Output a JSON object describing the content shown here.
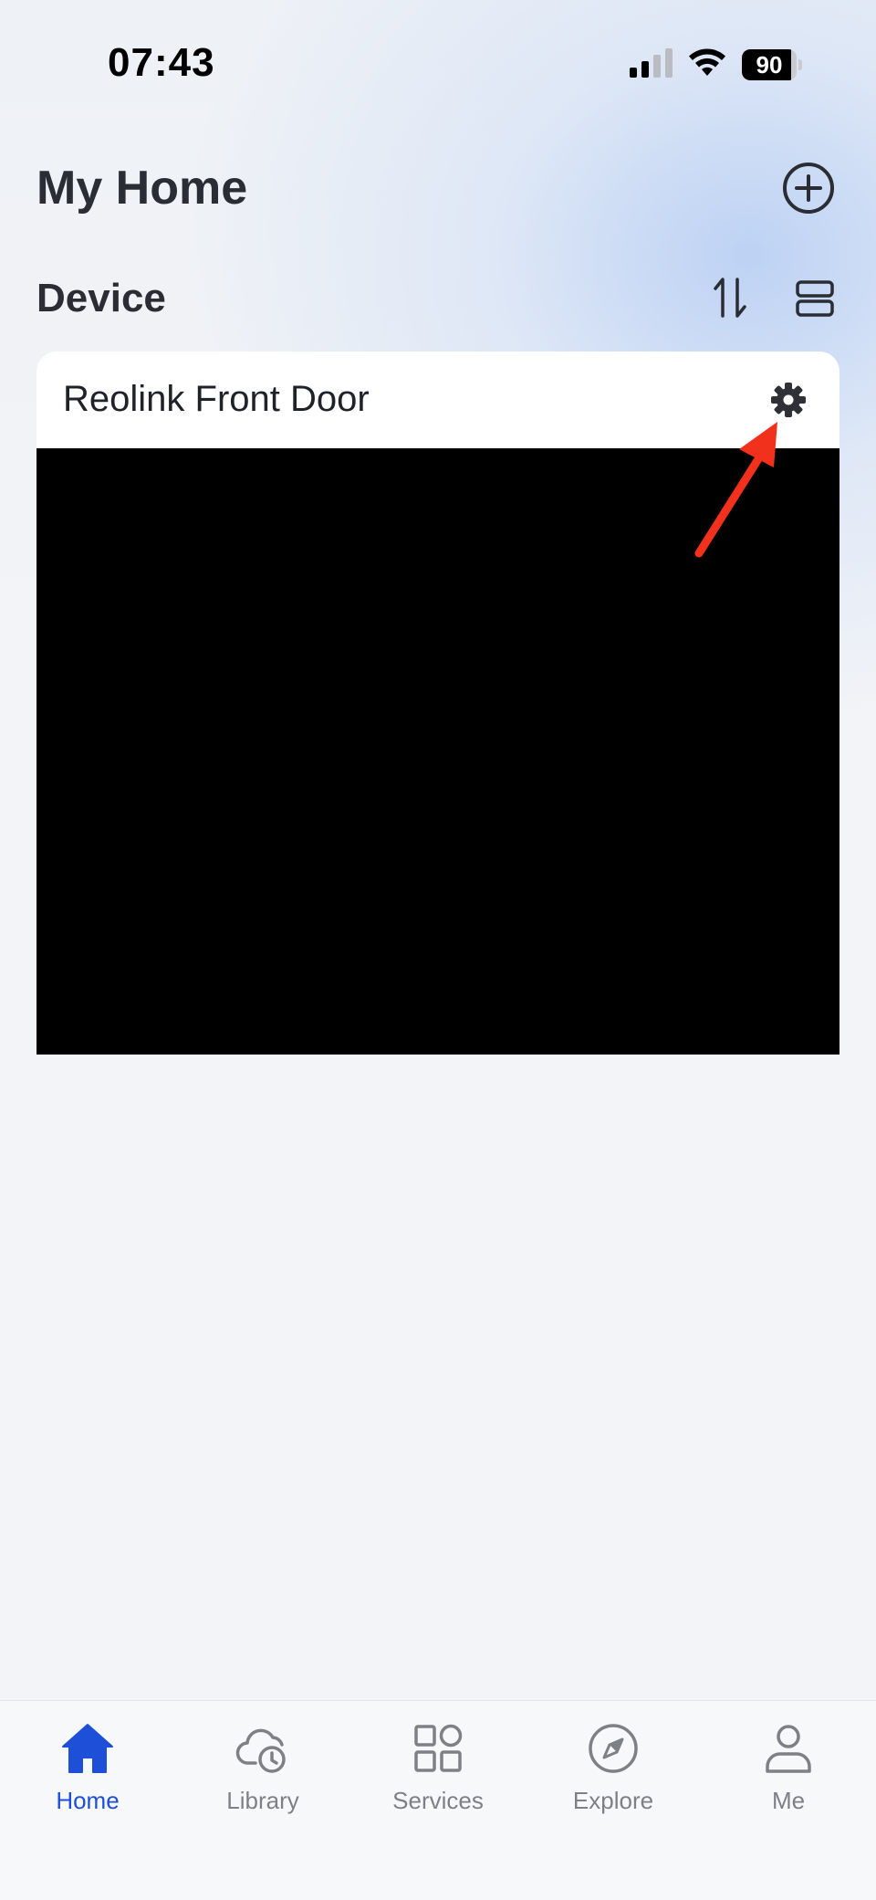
{
  "status_bar": {
    "time": "07:43",
    "battery_level": "90",
    "battery_fraction": 0.9,
    "signal_icon": "cellular-signal-icon",
    "wifi_icon": "wifi-icon"
  },
  "header": {
    "title": "My Home",
    "add_icon": "plus-circle-icon"
  },
  "device_section": {
    "title": "Device",
    "sort_icon": "sort-arrows-icon",
    "layout_icon": "list-layout-icon"
  },
  "devices": [
    {
      "name": "Reolink Front Door",
      "settings_icon": "gear-icon",
      "preview_color": "#000000"
    }
  ],
  "tab_bar": {
    "tabs": [
      {
        "label": "Home",
        "icon": "home-icon",
        "active": true
      },
      {
        "label": "Library",
        "icon": "cloud-clock-icon",
        "active": false
      },
      {
        "label": "Services",
        "icon": "grid-icon",
        "active": false
      },
      {
        "label": "Explore",
        "icon": "compass-icon",
        "active": false
      },
      {
        "label": "Me",
        "icon": "person-icon",
        "active": false
      }
    ]
  },
  "colors": {
    "accent": "#1d4fd8",
    "annotation_arrow": "#f2311d",
    "inactive_tab": "#7d8087"
  }
}
